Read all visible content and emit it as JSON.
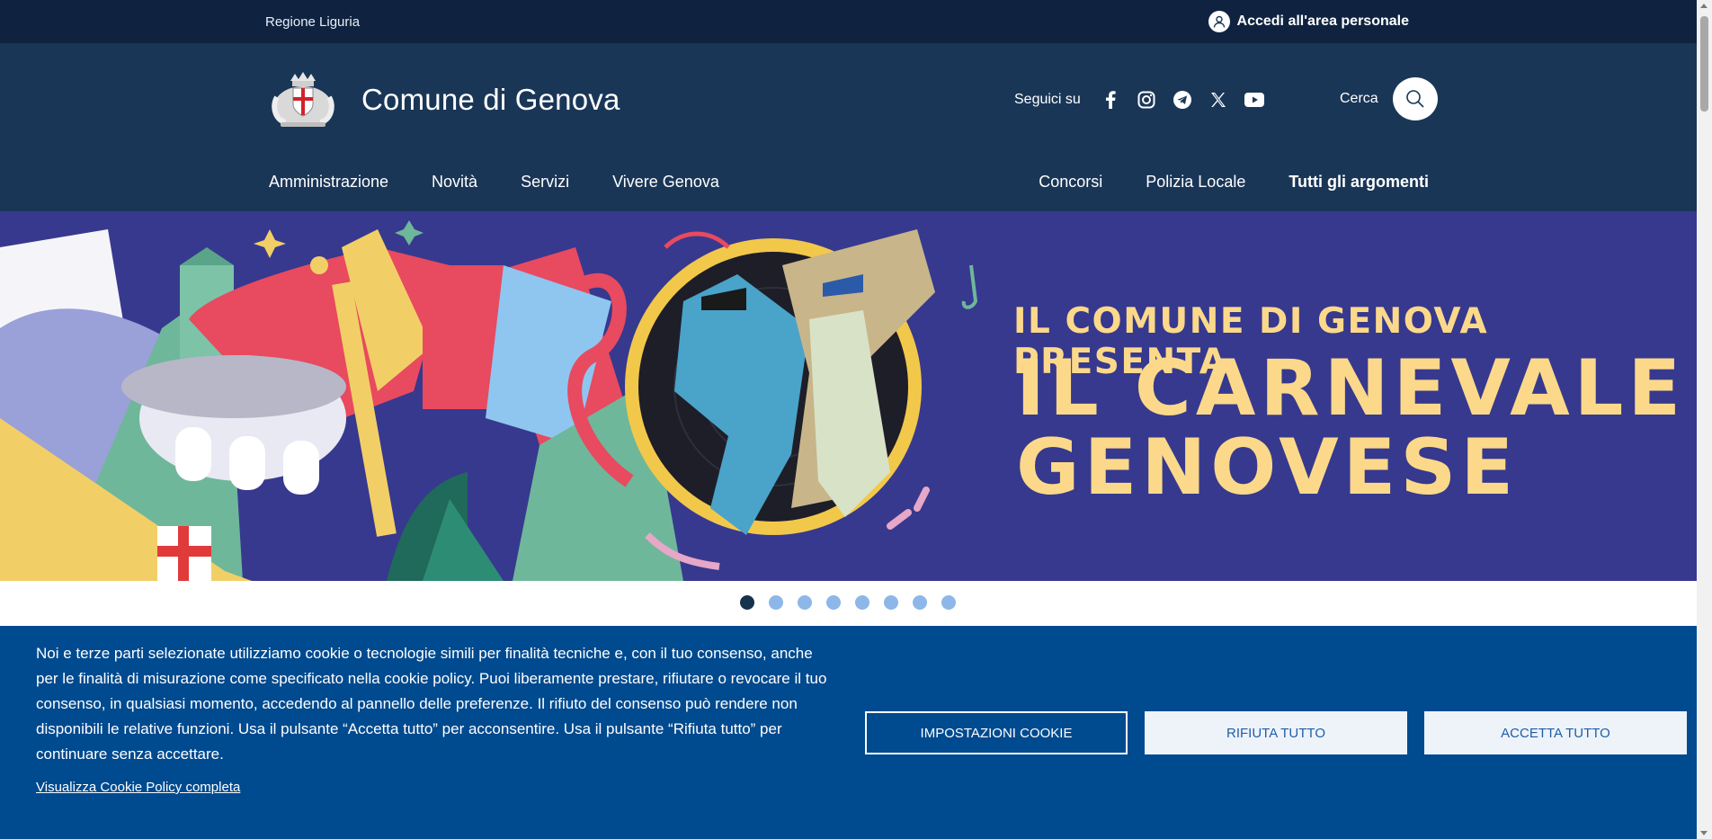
{
  "topbar": {
    "region": "Regione Liguria",
    "login": "Accedi all'area personale"
  },
  "header": {
    "title": "Comune di Genova",
    "social_label": "Seguici su",
    "social_icons": [
      "facebook-icon",
      "instagram-icon",
      "telegram-icon",
      "x-icon",
      "youtube-icon"
    ],
    "search_label": "Cerca"
  },
  "nav": {
    "left": [
      "Amministrazione",
      "Novità",
      "Servizi",
      "Vivere Genova"
    ],
    "right": [
      "Concorsi",
      "Polizia Locale",
      "Tutti gli argomenti"
    ]
  },
  "hero": {
    "line1": "IL COMUNE DI GENOVA PRESENTA",
    "line2": "IL CARNEVALE",
    "line3": "GENOVESE"
  },
  "carousel": {
    "slide_count": 8,
    "active_index": 0
  },
  "cookie": {
    "text": "Noi e terze parti selezionate utilizziamo cookie o tecnologie simili per finalità tecniche e, con il tuo consenso, anche per le finalità di misurazione come specificato nella cookie policy. Puoi liberamente prestare, rifiutare o revocare il tuo consenso, in qualsiasi momento, accedendo al pannello delle preferenze. Il rifiuto del consenso può rendere non disponibili le relative funzioni. Usa il pulsante “Accetta tutto” per acconsentire. Usa il pulsante “Rifiuta tutto” per continuare senza accettare.",
    "policy_link": "Visualizza Cookie Policy completa",
    "settings_button": "Impostazioni cookie",
    "reject_button": "Rifiuta tutto",
    "accept_button": "Accetta tutto"
  },
  "colors": {
    "topbar": "#0f2340",
    "header": "#1a3657",
    "hero_bg": "#37398e",
    "hero_text": "#fcd98a",
    "cookie_bg": "#004a8f",
    "dot_active": "#17324d",
    "dot_inactive": "#8db7e8"
  }
}
